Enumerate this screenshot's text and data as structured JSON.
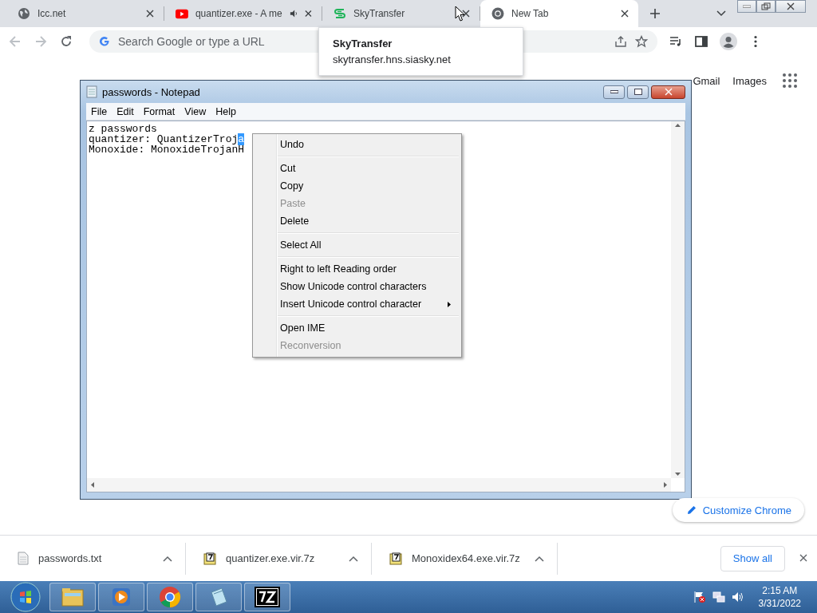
{
  "browser": {
    "tabs": [
      {
        "title": "Icc.net",
        "kind": "globe",
        "selected": false,
        "audio": false
      },
      {
        "title": "quantizer.exe - A me",
        "kind": "video",
        "selected": false,
        "audio": true
      },
      {
        "title": "SkyTransfer",
        "kind": "sky",
        "selected": false,
        "audio": false
      },
      {
        "title": "New Tab",
        "kind": "chrome",
        "selected": true,
        "audio": false
      }
    ],
    "tooltip": {
      "title": "SkyTransfer",
      "url": "skytransfer.hns.siasky.net"
    },
    "omnibox": {
      "placeholder": "Search Google or type a URL"
    },
    "new_tab_page": {
      "links": [
        "Gmail",
        "Images"
      ],
      "customize_button": "Customize Chrome"
    },
    "downloads": {
      "items": [
        {
          "name": "passwords.txt",
          "kind": "text"
        },
        {
          "name": "quantizer.exe.vir.7z",
          "kind": "archive"
        },
        {
          "name": "Monoxidex64.exe.vir.7z",
          "kind": "archive"
        }
      ],
      "show_all": "Show all"
    }
  },
  "notepad": {
    "title": "passwords - Notepad",
    "menu": [
      "File",
      "Edit",
      "Format",
      "View",
      "Help"
    ],
    "lines": [
      {
        "text": "z passwords"
      },
      {
        "text": "quantizer: QuantizerTroj",
        "selected_text": "a"
      },
      {
        "text": "Monoxide: MonoxideTrojanH"
      }
    ],
    "context_menu": {
      "items": [
        {
          "kind": "item",
          "label": "Undo",
          "disabled": false,
          "submenu": false
        },
        {
          "kind": "separator"
        },
        {
          "kind": "item",
          "label": "Cut",
          "disabled": false,
          "submenu": false
        },
        {
          "kind": "item",
          "label": "Copy",
          "disabled": false,
          "submenu": false
        },
        {
          "kind": "item",
          "label": "Paste",
          "disabled": true,
          "submenu": false
        },
        {
          "kind": "item",
          "label": "Delete",
          "disabled": false,
          "submenu": false
        },
        {
          "kind": "separator"
        },
        {
          "kind": "item",
          "label": "Select All",
          "disabled": false,
          "submenu": false
        },
        {
          "kind": "separator"
        },
        {
          "kind": "item",
          "label": "Right to left Reading order",
          "disabled": false,
          "submenu": false
        },
        {
          "kind": "item",
          "label": "Show Unicode control characters",
          "disabled": false,
          "submenu": false
        },
        {
          "kind": "item",
          "label": "Insert Unicode control character",
          "disabled": false,
          "submenu": true
        },
        {
          "kind": "separator"
        },
        {
          "kind": "item",
          "label": "Open IME",
          "disabled": false,
          "submenu": false
        },
        {
          "kind": "item",
          "label": "Reconversion",
          "disabled": true,
          "submenu": false
        }
      ]
    }
  },
  "taskbar": {
    "apps": [
      {
        "kind": "explorer"
      },
      {
        "kind": "media"
      },
      {
        "kind": "chrome"
      },
      {
        "kind": "notepad"
      },
      {
        "kind": "archiver"
      }
    ],
    "clock": {
      "time": "2:15 AM",
      "date": "3/31/2022"
    }
  }
}
